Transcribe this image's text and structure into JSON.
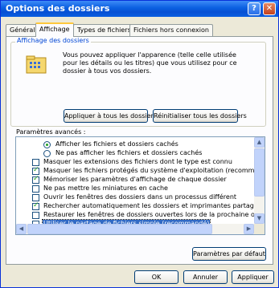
{
  "window": {
    "title": "Options des dossiers",
    "help_glyph": "?",
    "close_glyph": "✕"
  },
  "tabs": [
    {
      "label": "Général"
    },
    {
      "label": "Affichage"
    },
    {
      "label": "Types de fichiers"
    },
    {
      "label": "Fichiers hors connexion"
    }
  ],
  "folder_view": {
    "group_title": "Affichage des dossiers",
    "description": "Vous pouvez appliquer l'apparence (telle celle utilisée pour les détails ou les titres) que vous utilisez pour ce dossier à tous vos dossiers.",
    "apply_all_label": "Appliquer à tous les dossiers",
    "reset_all_label": "Réinitialiser tous les dossiers"
  },
  "advanced": {
    "label": "Paramètres avancés :",
    "items": [
      {
        "type": "radio",
        "checked": true,
        "label": "Afficher les fichiers et dossiers cachés"
      },
      {
        "type": "radio",
        "checked": false,
        "label": "Ne pas afficher les fichiers et dossiers cachés"
      },
      {
        "type": "checkbox",
        "checked": false,
        "label": "Masquer les extensions des fichiers dont le type est connu"
      },
      {
        "type": "checkbox",
        "checked": true,
        "label": "Masquer les fichiers protégés du système d'exploitation (recommandé)"
      },
      {
        "type": "checkbox",
        "checked": true,
        "label": "Mémoriser les paramètres d'affichage de chaque dossier"
      },
      {
        "type": "checkbox",
        "checked": false,
        "label": "Ne pas mettre les miniatures en cache"
      },
      {
        "type": "checkbox",
        "checked": false,
        "label": "Ouvrir les fenêtres des dossiers dans un processus différent"
      },
      {
        "type": "checkbox",
        "checked": true,
        "label": "Rechercher automatiquement les dossiers et imprimantes partagés"
      },
      {
        "type": "checkbox",
        "checked": false,
        "label": "Restaurer les fenêtres de dossiers ouvertes lors de la prochaine ouverture"
      },
      {
        "type": "checkbox",
        "checked": false,
        "selected": true,
        "label": "Utiliser le partage de fichiers simple (recommandé)"
      }
    ],
    "scroll_up": "▲",
    "scroll_down": "▼",
    "scroll_left": "◀",
    "scroll_right": "▶"
  },
  "defaults_button": "Paramètres par défaut",
  "footer": {
    "ok": "OK",
    "cancel": "Annuler",
    "apply": "Appliquer"
  },
  "colors": {
    "titlebar": "#0a5fe0",
    "dialog_bg": "#ece9d8",
    "selection": "#316ac5",
    "check": "#21a121"
  }
}
